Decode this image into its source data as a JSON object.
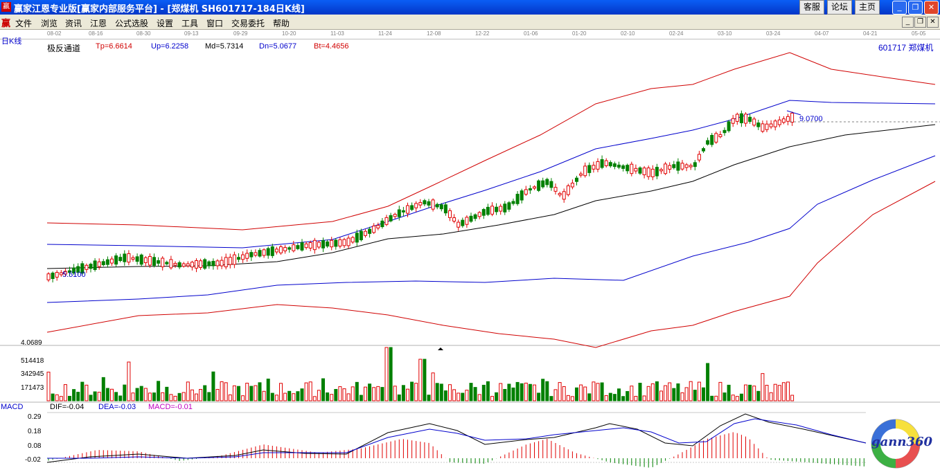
{
  "window": {
    "title": "赢家江恩专业版[赢家内部服务平台] - [郑煤机  SH601717-184日K线]",
    "icon_text": "赢",
    "buttons": [
      "客服",
      "论坛",
      "主页"
    ],
    "controls": [
      "_",
      "❐",
      "✕"
    ]
  },
  "menu": {
    "logo": "赢",
    "items": [
      "文件",
      "浏览",
      "资讯",
      "江恩",
      "公式选股",
      "设置",
      "工具",
      "窗口",
      "交易委托",
      "帮助"
    ],
    "mdi_controls": [
      "_",
      "❐",
      "✕"
    ]
  },
  "date_axis": [
    "08-02",
    "08-16",
    "08-30",
    "09-13",
    "09-29",
    "10-20",
    "11-03",
    "11-24",
    "12-08",
    "12-22",
    "01-06",
    "01-20",
    "02-10",
    "02-24",
    "03-10",
    "03-24",
    "04-07",
    "04-21",
    "05-05"
  ],
  "kline": {
    "period_label": "日K线",
    "indicator_name": "极反通道",
    "tp": "Tp=6.6614",
    "up": "Up=6.2258",
    "md": "Md=5.7314",
    "dn": "Dn=5.0677",
    "bt": "Bt=4.4656",
    "stock": "601717 郑煤机",
    "low_label": "5.5100",
    "high_label": "9.0700"
  },
  "volume": {
    "ticks": [
      "4.0689",
      "514418",
      "342945",
      "171473"
    ]
  },
  "macd": {
    "title": "MACD",
    "dif": "DIF=-0.04",
    "dea": "DEA=-0.03",
    "macd": "MACD=-0.01",
    "ticks": [
      "0.29",
      "0.18",
      "0.08",
      "-0.02"
    ]
  },
  "logo": {
    "text": "gann360"
  },
  "colors": {
    "up": "#e00000",
    "down": "#008000",
    "channel_outer": "#d00000",
    "channel_inner": "#0000cc",
    "mid": "#000000",
    "title_bar": "#0a5ef5"
  }
}
